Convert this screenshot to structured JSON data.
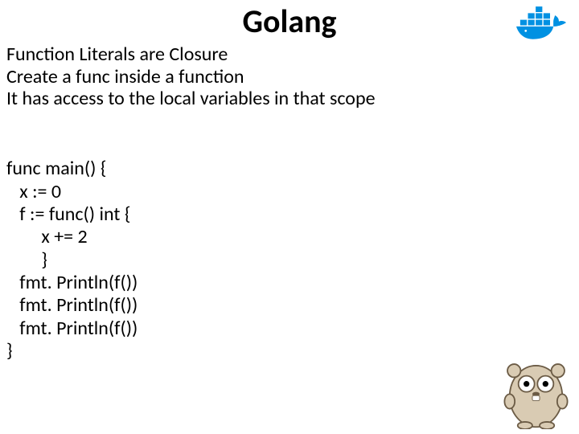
{
  "title": "Golang",
  "bullets": {
    "b1": "Function Literals are Closure",
    "b2": "Create a func inside a function",
    "b3": "It has access to the local variables in that scope"
  },
  "code": {
    "l1": "func main() {",
    "l2": "   x := 0",
    "l3": "   f := func() int {",
    "l4": "        x += 2",
    "l5": "        }",
    "l6": "   fmt. Println(f())",
    "l7": "   fmt. Println(f())",
    "l8": "   fmt. Println(f())",
    "l9": "}"
  },
  "icons": {
    "docker": "docker-whale-icon",
    "gopher": "go-gopher-icon"
  }
}
